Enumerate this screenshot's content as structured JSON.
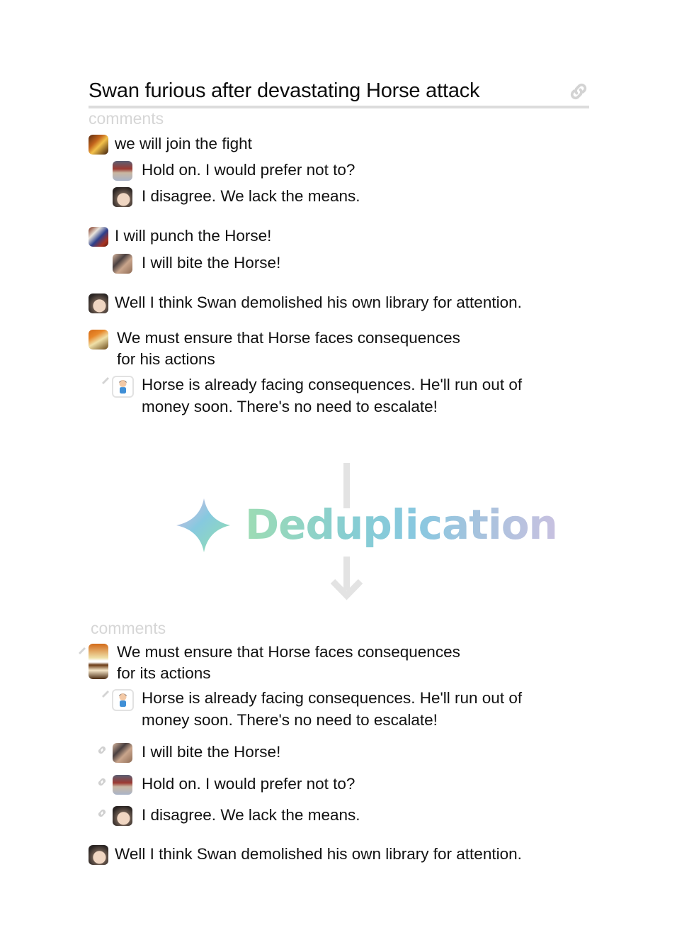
{
  "header": {
    "title": "Swan furious after devastating Horse attack",
    "link_icon": "link-icon"
  },
  "before": {
    "section_label": "comments",
    "comments": [
      {
        "avatar": "fight-avatar",
        "text": "we will join the fight",
        "replies": [
          {
            "avatar": "man-avatar",
            "text": "Hold on. I would prefer not to?"
          },
          {
            "avatar": "egg-avatar",
            "text": "I disagree. We lack the means."
          }
        ]
      },
      {
        "avatar": "punch-avatar",
        "text": "I will punch the Horse!",
        "replies": [
          {
            "avatar": "bite-avatar",
            "text": "I will bite the Horse!"
          }
        ]
      },
      {
        "avatar": "egg-avatar",
        "text": "Well I think Swan demolished his own library for attention.",
        "replies": []
      },
      {
        "avatar": "gavel-avatar",
        "text_line1": "We must ensure that Horse faces consequences",
        "text_line2": "for his actions",
        "replies": [
          {
            "avatar": "kid-avatar",
            "marker": "pencil-icon",
            "text_line1": "Horse is already facing consequences. He'll run out of",
            "text_line2": "money soon. There's no need to escalate!"
          }
        ]
      }
    ]
  },
  "process": {
    "label": "Deduplication",
    "icon": "sparkle-icon",
    "arrow": "arrow-down-icon",
    "gradient_colors": [
      "#9ddcb4",
      "#86cdd3",
      "#88c8e0",
      "#a7c3de",
      "#c8c1e0"
    ]
  },
  "after": {
    "section_label": "comments",
    "comments": [
      {
        "avatar": "stacked-avatar",
        "marker": "pencil-icon",
        "text_line1": "We must ensure that Horse faces consequences",
        "text_line2": "for its actions"
      },
      {
        "avatar": "kid-avatar",
        "marker": "pencil-icon",
        "text_line1": "Horse is already facing consequences. He'll run out of",
        "text_line2": "money soon. There's no need to escalate!"
      },
      {
        "avatar": "bite-avatar",
        "marker": "link-icon",
        "text": "I will bite the Horse!"
      },
      {
        "avatar": "man-avatar",
        "marker": "link-icon",
        "text": "Hold on. I would prefer not to?"
      },
      {
        "avatar": "egg-avatar",
        "marker": "link-icon",
        "text": "I disagree. We lack the means."
      },
      {
        "avatar": "egg-avatar",
        "text": "Well I think Swan demolished his own library for attention."
      }
    ]
  }
}
